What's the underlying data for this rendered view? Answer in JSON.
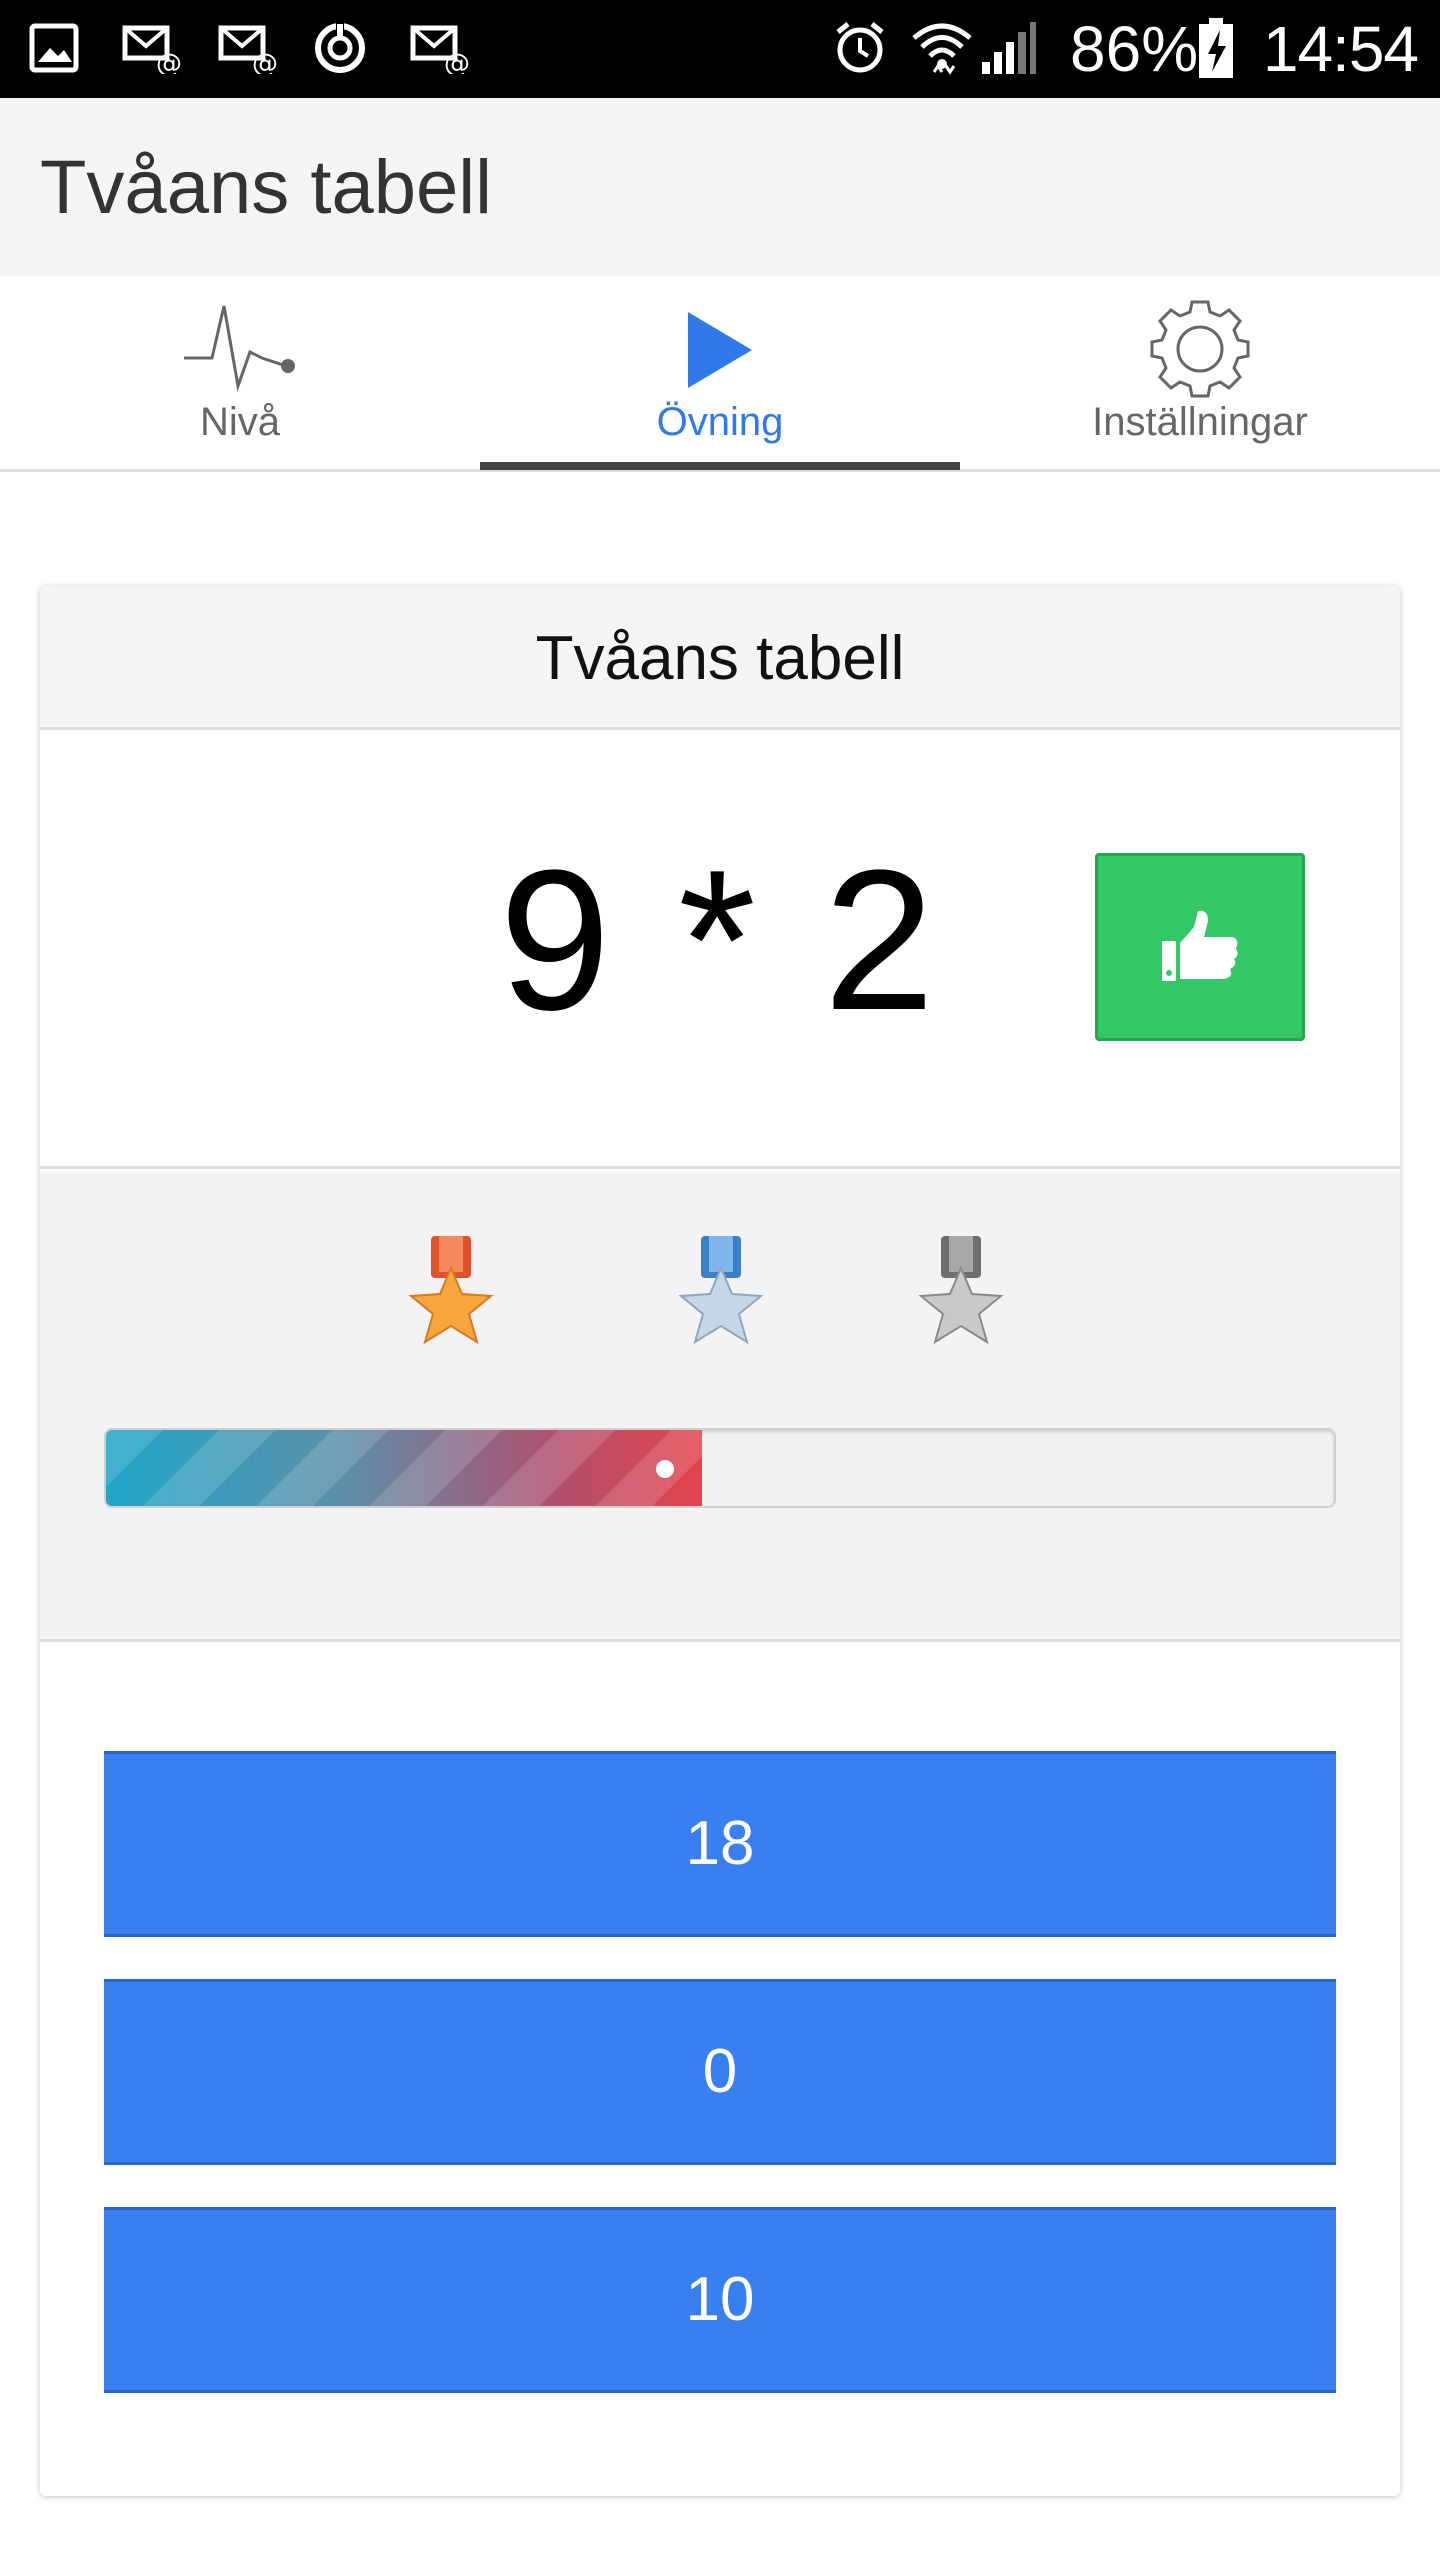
{
  "status_bar": {
    "battery_percent": "86%",
    "time": "14:54",
    "left_icons": [
      "image-icon",
      "email-notification-icon",
      "email-notification-icon",
      "sync-icon",
      "email-notification-icon"
    ],
    "right_icons": [
      "alarm-icon",
      "wifi-icon",
      "signal-icon",
      "battery-charging-icon"
    ]
  },
  "app_bar": {
    "title": "Tvåans tabell"
  },
  "tabs": [
    {
      "label": "Nivå",
      "icon": "pulse-icon",
      "active": false
    },
    {
      "label": "Övning",
      "icon": "play-icon",
      "active": true
    },
    {
      "label": "Inställningar",
      "icon": "gear-icon",
      "active": false
    }
  ],
  "card": {
    "title": "Tvåans tabell",
    "question": "9 * 2",
    "thumb_button_icon": "thumbs-up-icon",
    "medals": [
      "bronze-star-medal",
      "silver-blue-star-medal",
      "gray-star-medal"
    ],
    "progress_fraction": 0.485,
    "answers": [
      "18",
      "0",
      "10"
    ]
  },
  "colors": {
    "accent": "#2f7ae8",
    "answer_button": "#3a7ff0",
    "thumb_button": "#33c866"
  }
}
